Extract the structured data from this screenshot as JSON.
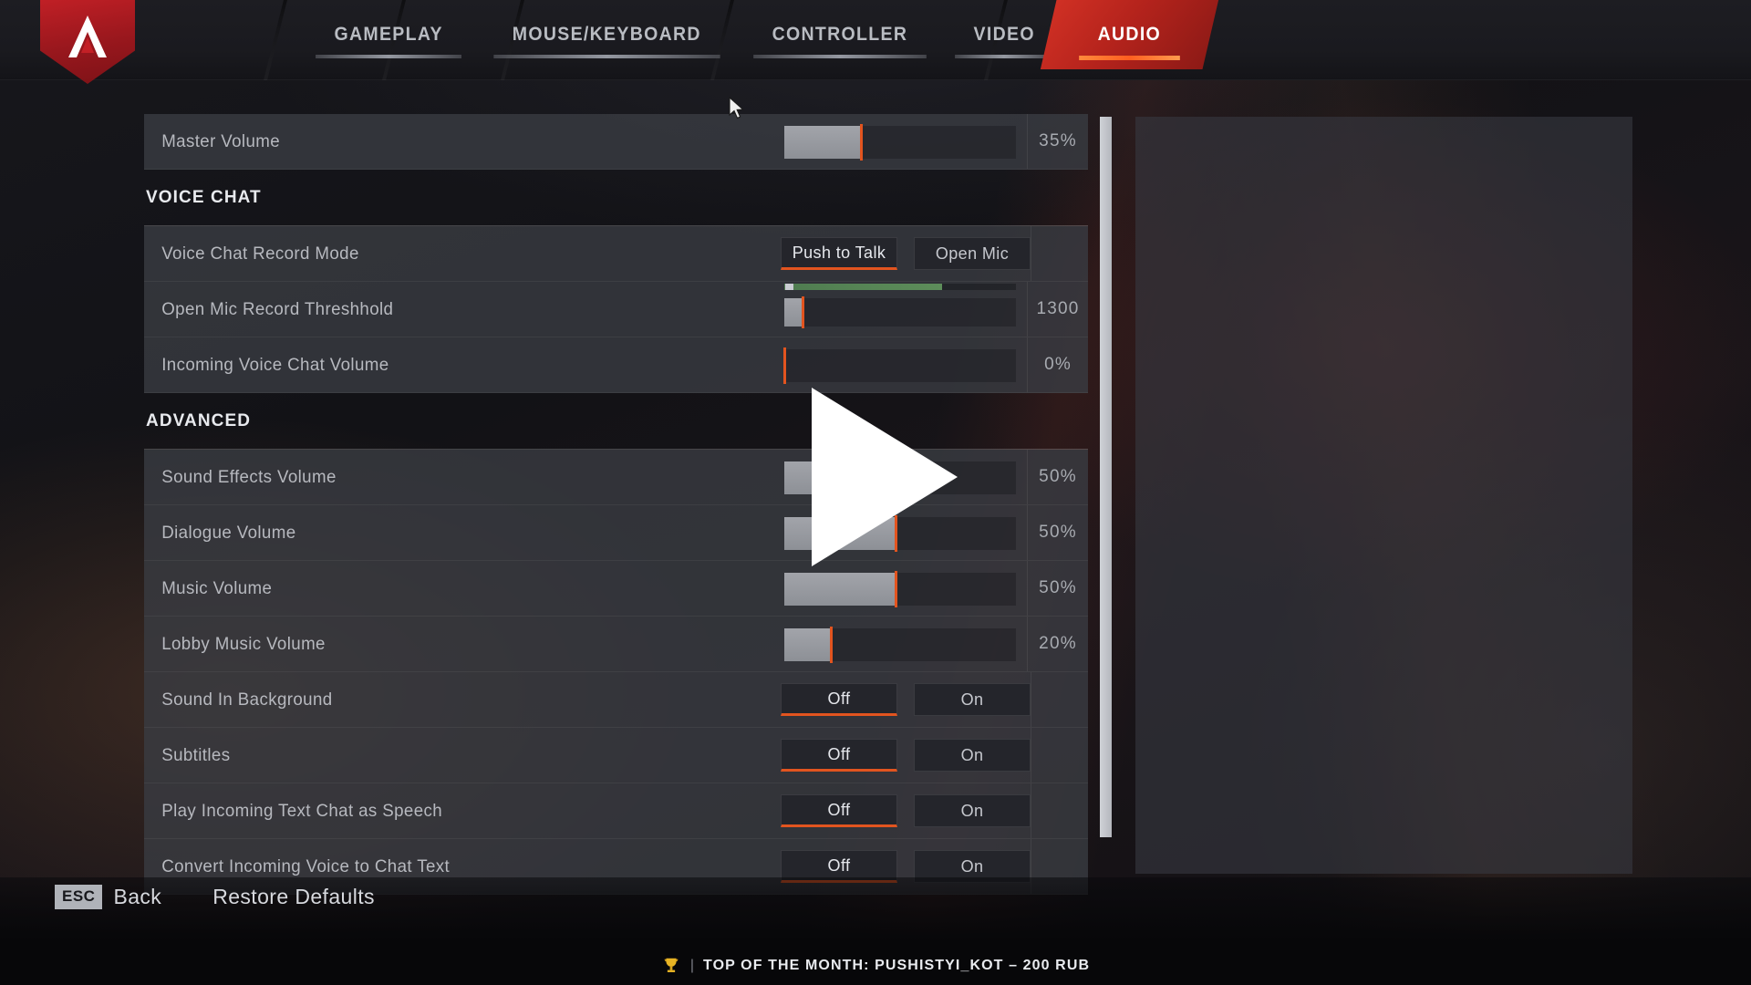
{
  "app": {
    "title": "Apex Legends Settings"
  },
  "logo": {
    "icon": "apex-logo-icon"
  },
  "nav": {
    "tabs": [
      {
        "label": "GAMEPLAY",
        "selected": false
      },
      {
        "label": "MOUSE/KEYBOARD",
        "selected": false
      },
      {
        "label": "CONTROLLER",
        "selected": false
      },
      {
        "label": "VIDEO",
        "selected": false
      },
      {
        "label": "AUDIO",
        "selected": true
      }
    ]
  },
  "settings": {
    "rows": [
      {
        "kind": "slider",
        "label": "Master Volume",
        "value": "35%",
        "fill_pct": 33,
        "name": "master-volume"
      },
      {
        "kind": "section",
        "label": "VOICE CHAT",
        "name": "voice-chat"
      },
      {
        "kind": "toggle",
        "label": "Voice Chat Record Mode",
        "options": [
          "Push to Talk",
          "Open Mic"
        ],
        "selected": "Push to Talk",
        "value": "",
        "name": "voice-chat-record-mode"
      },
      {
        "kind": "meter",
        "label": "Open Mic Record Threshhold",
        "value": "1300",
        "fill_pct": 8,
        "meter_pct": 68,
        "name": "open-mic-record-threshold"
      },
      {
        "kind": "slider",
        "label": "Incoming Voice Chat Volume",
        "value": "0%",
        "fill_pct": 0,
        "name": "incoming-voice-chat-volume"
      },
      {
        "kind": "section",
        "label": "ADVANCED",
        "name": "advanced"
      },
      {
        "kind": "slider",
        "label": "Sound Effects Volume",
        "value": "50%",
        "fill_pct": 48,
        "name": "sound-effects-volume"
      },
      {
        "kind": "slider",
        "label": "Dialogue Volume",
        "value": "50%",
        "fill_pct": 48,
        "name": "dialogue-volume"
      },
      {
        "kind": "slider",
        "label": "Music Volume",
        "value": "50%",
        "fill_pct": 48,
        "name": "music-volume"
      },
      {
        "kind": "slider",
        "label": "Lobby Music Volume",
        "value": "20%",
        "fill_pct": 20,
        "name": "lobby-music-volume"
      },
      {
        "kind": "toggle",
        "label": "Sound In Background",
        "options": [
          "Off",
          "On"
        ],
        "selected": "Off",
        "value": "",
        "name": "sound-in-background"
      },
      {
        "kind": "toggle",
        "label": "Subtitles",
        "options": [
          "Off",
          "On"
        ],
        "selected": "Off",
        "value": "",
        "name": "subtitles"
      },
      {
        "kind": "toggle",
        "label": "Play Incoming Text Chat as Speech",
        "options": [
          "Off",
          "On"
        ],
        "selected": "Off",
        "value": "",
        "name": "play-incoming-text-chat-as-speech"
      },
      {
        "kind": "toggle",
        "label": "Convert Incoming Voice to Chat Text",
        "options": [
          "Off",
          "On"
        ],
        "selected": "Off",
        "value": "",
        "name": "convert-incoming-voice-to-chat-text"
      }
    ]
  },
  "footer": {
    "back_key": "ESC",
    "back_label": "Back",
    "restore_label": "Restore Defaults"
  },
  "ticker": {
    "icon": "trophy-icon",
    "text": "TOP OF THE MONTH: PUSHISTYI_KOT – 200 RUB"
  },
  "overlay": {
    "play_icon": "play-triangle-icon"
  },
  "colors": {
    "accent_orange": "#e2541f",
    "brand_red": "#c32026",
    "meter_green": "#5d8d5a",
    "row_bg": "#3a3c42",
    "text": "#b7b9bf"
  }
}
